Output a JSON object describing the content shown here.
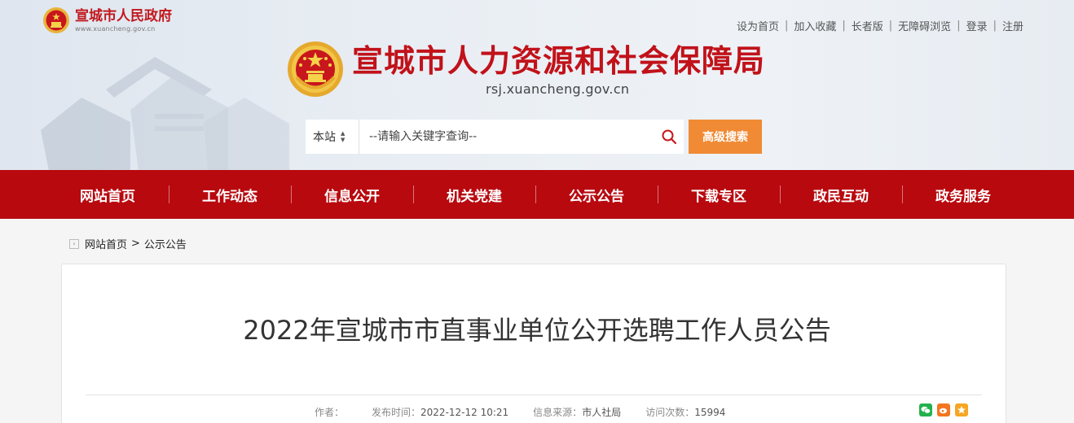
{
  "gov": {
    "name": "宣城市人民政府",
    "url": "www.xuancheng.gov.cn"
  },
  "top_links": [
    "设为首页",
    "加入收藏",
    "长者版",
    "无障碍浏览",
    "登录",
    "注册"
  ],
  "site": {
    "title": "宣城市人力资源和社会保障局",
    "url": "rsj.xuancheng.gov.cn"
  },
  "search": {
    "scope": "本站",
    "placeholder": "--请输入关键字查询--",
    "value": "",
    "advanced_label": "高级搜索"
  },
  "nav": [
    "网站首页",
    "工作动态",
    "信息公开",
    "机关党建",
    "公示公告",
    "下载专区",
    "政民互动",
    "政务服务"
  ],
  "breadcrumb": {
    "home": "网站首页",
    "separator": ">",
    "current": "公示公告"
  },
  "article": {
    "title": "2022年宣城市市直事业单位公开选聘工作人员公告",
    "author_label": "作者：",
    "author": "",
    "time_label": "发布时间：",
    "time": "2022-12-12 10:21",
    "source_label": "信息来源：",
    "source": "市人社局",
    "views_label": "访问次数：",
    "views": "15994"
  },
  "share_icons": [
    "wechat-icon",
    "weibo-icon",
    "favorite-icon"
  ],
  "colors": {
    "brand_red": "#b8090f",
    "title_red": "#c1121a",
    "search_orange": "#f08a35",
    "wechat_green": "#23b14d",
    "weibo_orange": "#f2761f",
    "favorite_orange": "#f6a623"
  }
}
